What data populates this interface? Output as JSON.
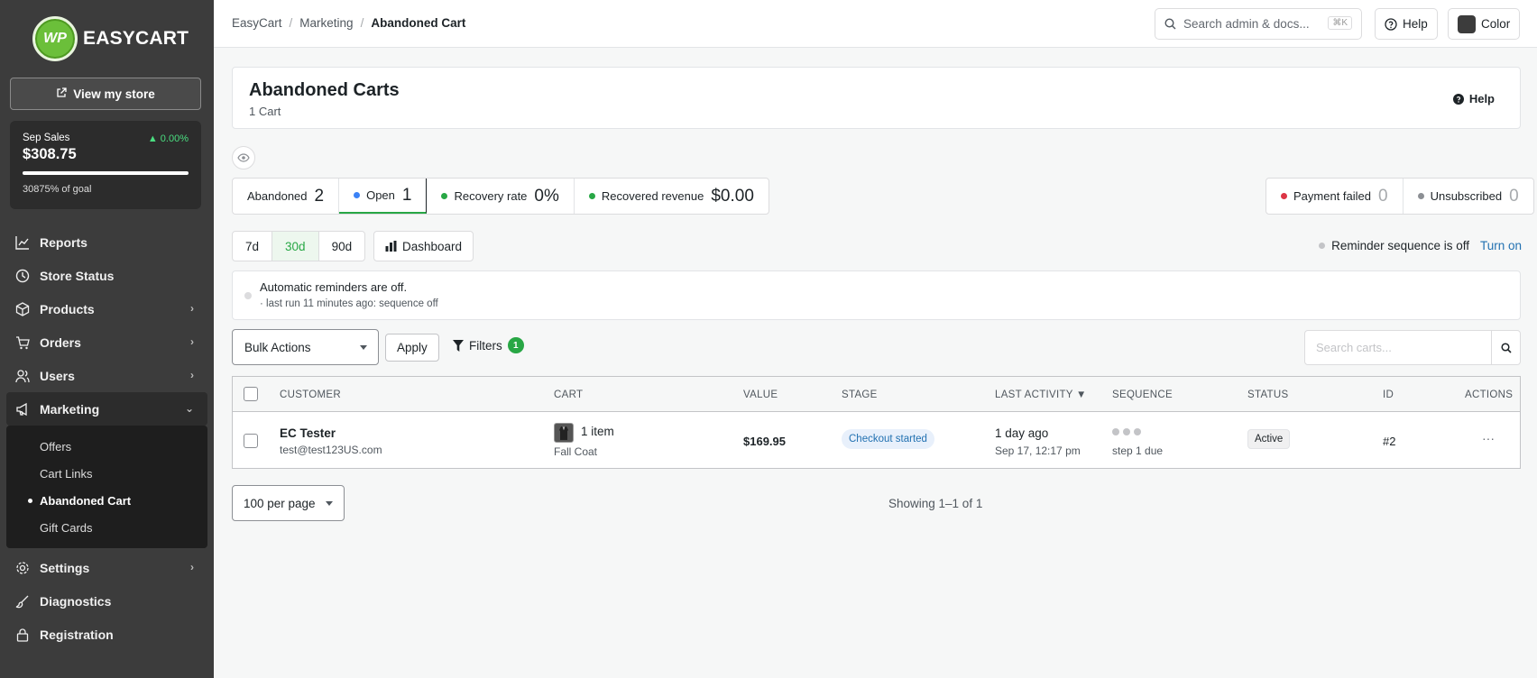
{
  "brand": {
    "name": "EASYCART",
    "logo_text": "WP"
  },
  "sidebar": {
    "view_store_label": "View my store",
    "sales": {
      "label": "Sep Sales",
      "delta": "▲ 0.00%",
      "value": "$308.75",
      "goal_text": "30875% of goal",
      "progress": 1.0
    },
    "nav": [
      {
        "label": "Reports",
        "icon": "reports-icon"
      },
      {
        "label": "Store Status",
        "icon": "clock-icon"
      },
      {
        "label": "Products",
        "icon": "box-icon"
      },
      {
        "label": "Orders",
        "icon": "cart-icon"
      },
      {
        "label": "Users",
        "icon": "users-icon"
      },
      {
        "label": "Marketing",
        "icon": "megaphone-icon"
      },
      {
        "label": "Settings",
        "icon": "gear-icon"
      },
      {
        "label": "Diagnostics",
        "icon": "brush-icon"
      },
      {
        "label": "Registration",
        "icon": "lock-icon"
      }
    ],
    "submenu": [
      {
        "label": "Offers"
      },
      {
        "label": "Cart Links"
      },
      {
        "label": "Abandoned Cart"
      },
      {
        "label": "Gift Cards"
      }
    ]
  },
  "topbar": {
    "breadcrumb": [
      "EasyCart",
      "Marketing",
      "Abandoned Cart"
    ],
    "search_placeholder": "Search admin & docs...",
    "search_shortcut": "⌘K",
    "help_label": "Help",
    "color_label": "Color"
  },
  "page": {
    "title": "Abandoned Carts",
    "subtitle": "1 Cart",
    "help_label": "Help"
  },
  "stats": {
    "abandoned": {
      "label": "Abandoned",
      "value": "2"
    },
    "open": {
      "label": "Open",
      "value": "1"
    },
    "recovery_rate": {
      "label": "Recovery rate",
      "value": "0%"
    },
    "recovered_revenue": {
      "label": "Recovered revenue",
      "value": "$0.00"
    },
    "payment_failed": {
      "label": "Payment failed",
      "value": "0"
    },
    "unsubscribed": {
      "label": "Unsubscribed",
      "value": "0"
    }
  },
  "ranges": [
    "7d",
    "30d",
    "90d"
  ],
  "dashboard_label": "Dashboard",
  "reminder": {
    "status": "Reminder sequence is off",
    "action": "Turn on"
  },
  "notice": {
    "line1": "Automatic reminders are off.",
    "line2": "· last run 11 minutes ago: sequence off"
  },
  "toolbar": {
    "bulk_actions": "Bulk Actions",
    "apply": "Apply",
    "filters": "Filters",
    "filter_count": "1",
    "search_placeholder": "Search carts..."
  },
  "table": {
    "columns": [
      "CUSTOMER",
      "CART",
      "VALUE",
      "STAGE",
      "LAST ACTIVITY ▼",
      "SEQUENCE",
      "STATUS",
      "ID",
      "ACTIONS"
    ],
    "rows": [
      {
        "customer_name": "EC Tester",
        "customer_email": "test@test123US.com",
        "cart_items": "1 item",
        "cart_product": "Fall Coat",
        "value": "$169.95",
        "stage": "Checkout started",
        "last_activity": "1 day ago",
        "last_activity_date": "Sep 17, 12:17 pm",
        "sequence": "step 1 due",
        "status": "Active",
        "id": "#2",
        "actions": "···"
      }
    ]
  },
  "pagination": {
    "per_page": "100 per page",
    "showing": "Showing 1–1 of 1"
  },
  "colors": {
    "accent": "#28a745",
    "link": "#2271b1",
    "sidebar_bg": "#3c3c3c",
    "danger": "#dc3545"
  }
}
